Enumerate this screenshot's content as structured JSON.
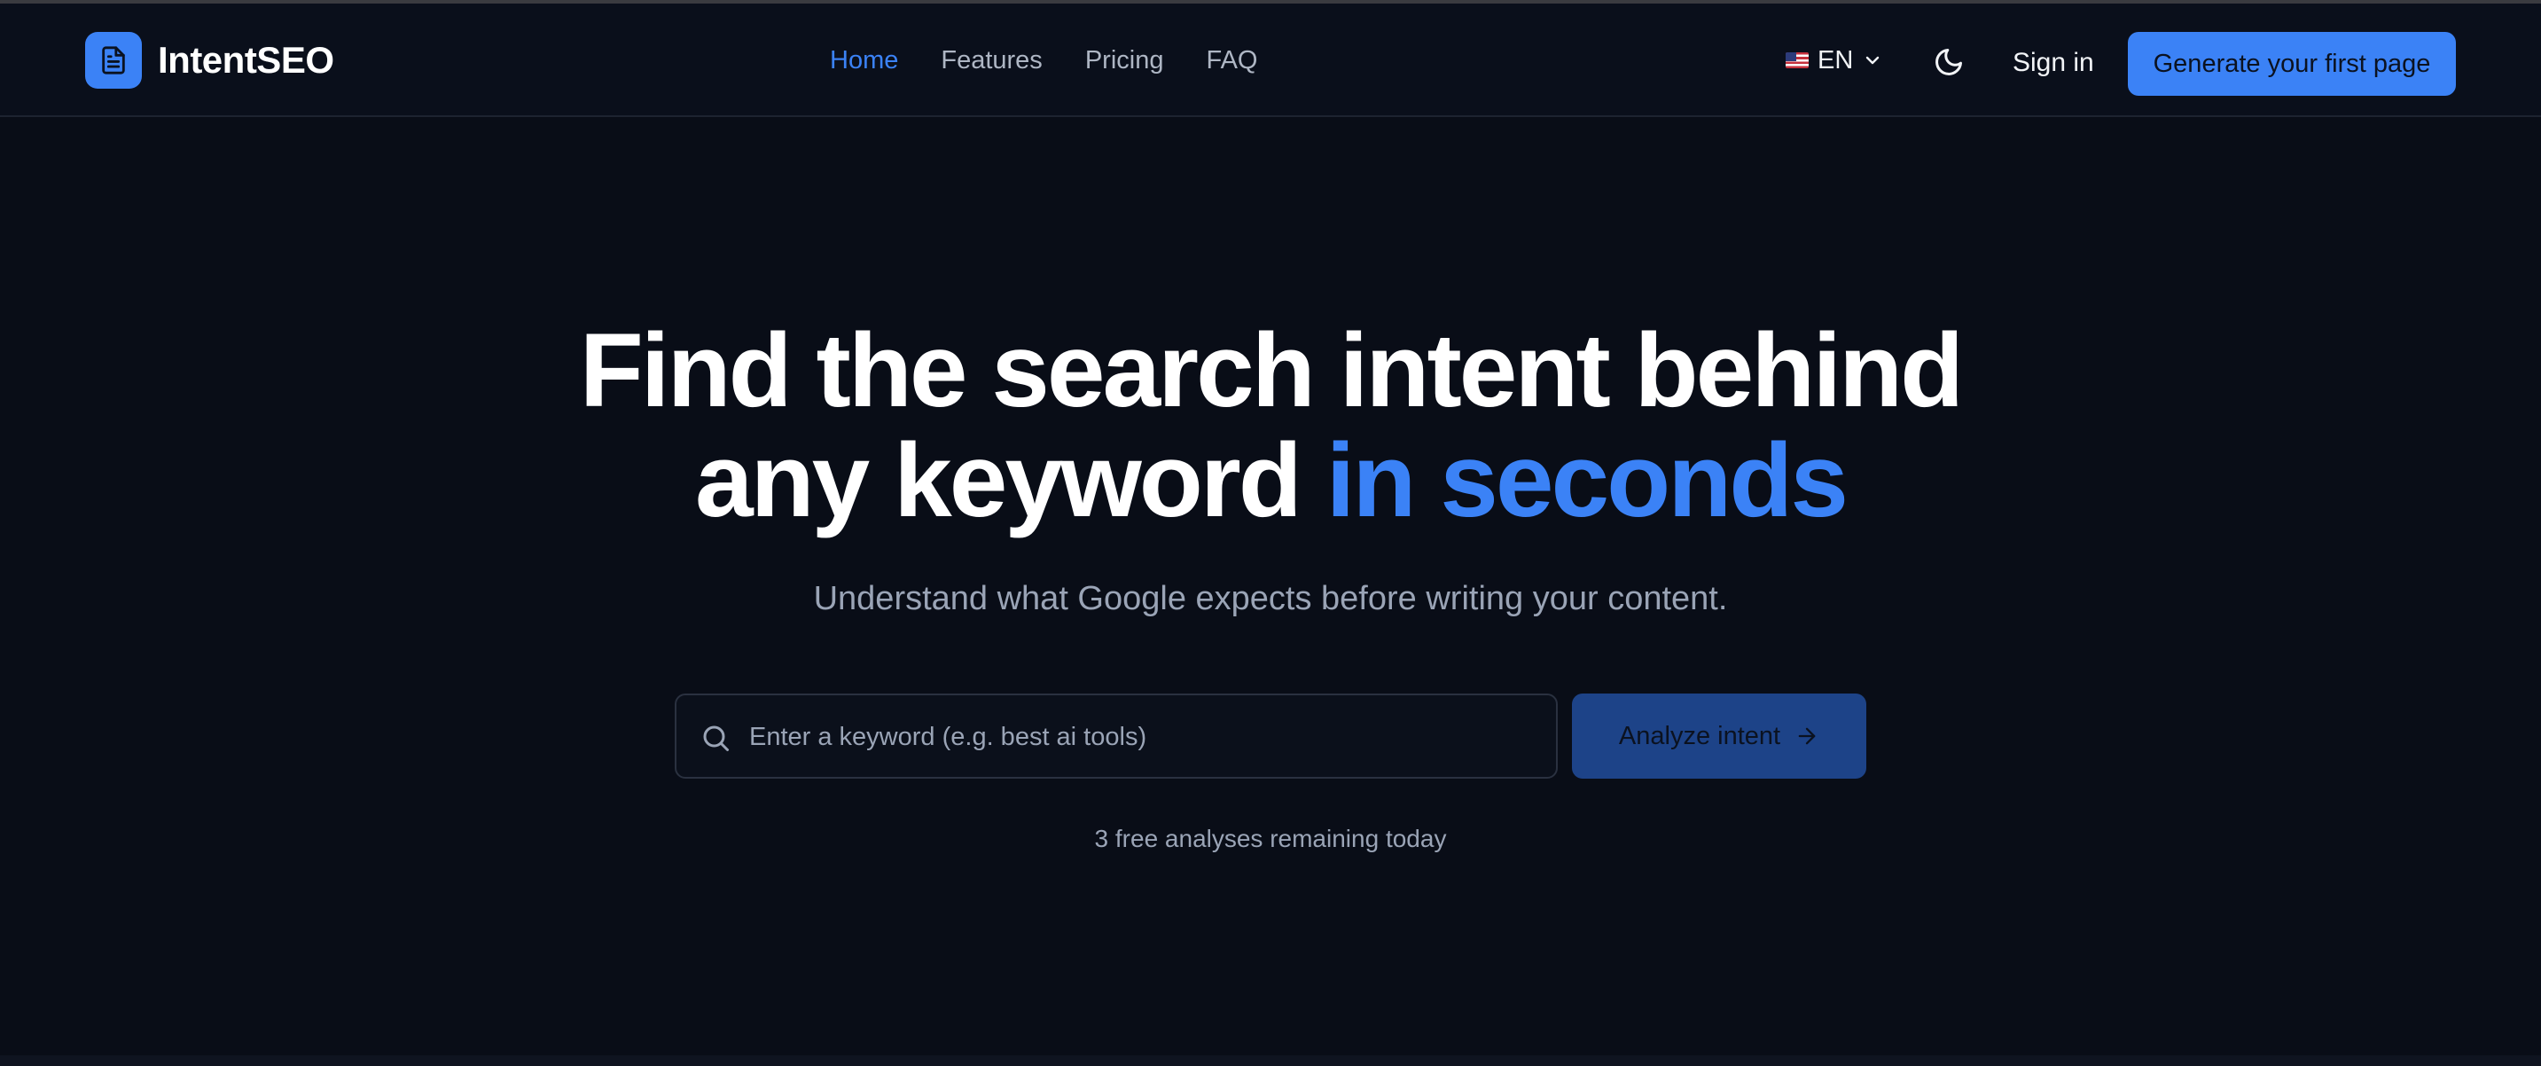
{
  "brand": {
    "name": "IntentSEO",
    "logo_icon": "document-icon",
    "accent_color": "#3b82f6"
  },
  "nav": {
    "links": [
      {
        "label": "Home",
        "active": true
      },
      {
        "label": "Features",
        "active": false
      },
      {
        "label": "Pricing",
        "active": false
      },
      {
        "label": "FAQ",
        "active": false
      }
    ]
  },
  "header": {
    "language": {
      "code": "EN",
      "flag": "us-flag-icon"
    },
    "theme_icon": "moon-icon",
    "signin_label": "Sign in",
    "cta_label": "Generate your first page"
  },
  "hero": {
    "title_line1": "Find the search intent behind",
    "title_line2_plain": "any keyword",
    "title_line2_accent": "in seconds",
    "subtitle": "Understand what Google expects before writing your content."
  },
  "search": {
    "placeholder": "Enter a keyword (e.g. best ai tools)",
    "value": "",
    "button_label": "Analyze intent",
    "remaining_text": "3 free analyses remaining today"
  }
}
